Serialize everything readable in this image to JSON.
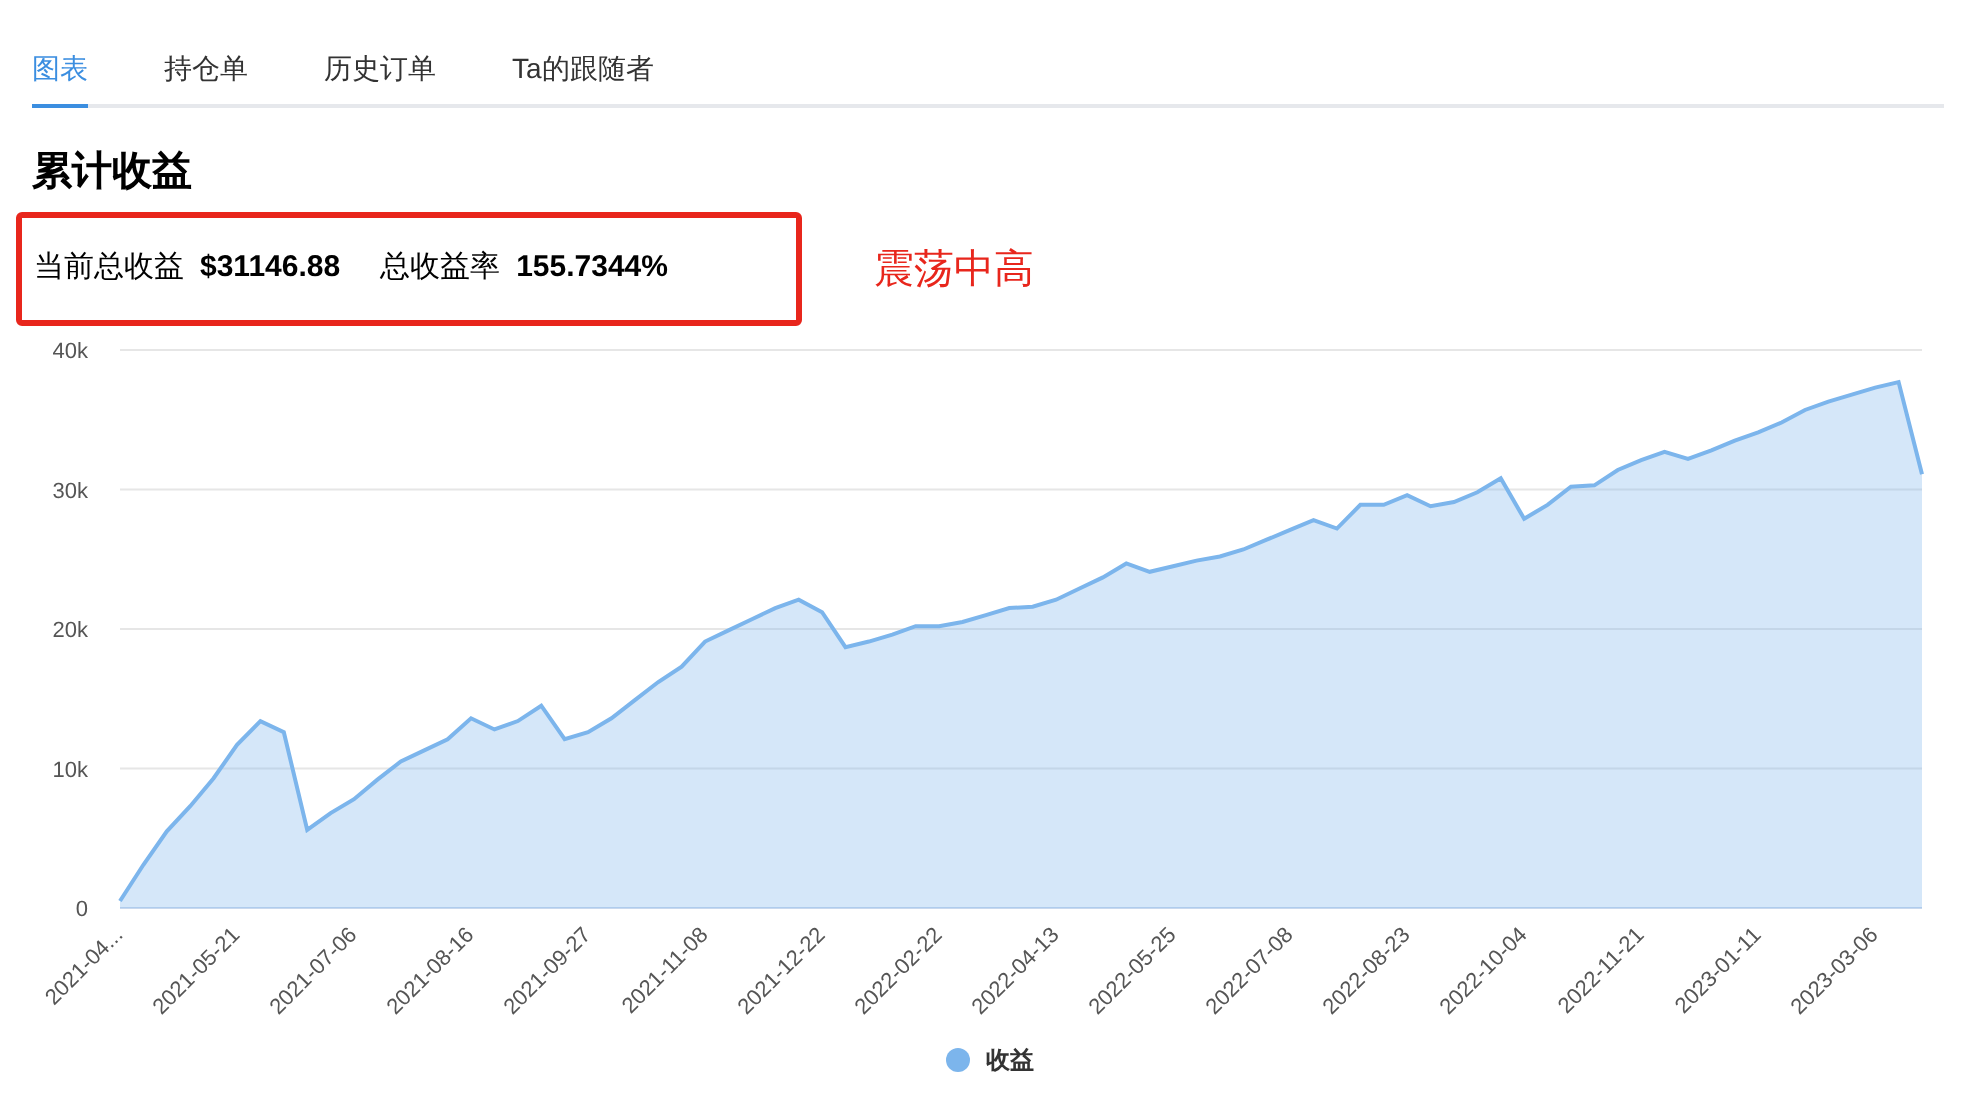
{
  "tabs": [
    {
      "label": "图表",
      "selected": true
    },
    {
      "label": "持仓单",
      "selected": false
    },
    {
      "label": "历史订单",
      "selected": false
    },
    {
      "label": "Ta的跟随者",
      "selected": false
    }
  ],
  "section_title": "累计收益",
  "summary": {
    "profit_label": "当前总收益",
    "profit_value": "$31146.88",
    "rate_label": "总收益率",
    "rate_value": "155.7344%"
  },
  "annotation": "震荡中高",
  "chart_data": {
    "type": "area",
    "categories": [
      "2021-04...",
      null,
      null,
      null,
      null,
      "2021-05-21",
      null,
      null,
      null,
      null,
      "2021-07-06",
      null,
      null,
      null,
      null,
      "2021-08-16",
      null,
      null,
      null,
      null,
      "2021-09-27",
      null,
      null,
      null,
      null,
      "2021-11-08",
      null,
      null,
      null,
      null,
      "2021-12-22",
      null,
      null,
      null,
      null,
      "2022-02-22",
      null,
      null,
      null,
      null,
      "2022-04-13",
      null,
      null,
      null,
      null,
      "2022-05-25",
      null,
      null,
      null,
      null,
      "2022-07-08",
      null,
      null,
      null,
      null,
      "2022-08-23",
      null,
      null,
      null,
      null,
      "2022-10-04",
      null,
      null,
      null,
      null,
      "2022-11-21",
      null,
      null,
      null,
      null,
      "2023-01-11",
      null,
      null,
      null,
      null,
      "2023-03-06",
      null,
      null
    ],
    "grid": true,
    "ylim": [
      0,
      40000
    ],
    "yticks": [
      {
        "value": 0,
        "label": "0"
      },
      {
        "value": 10000,
        "label": "10k"
      },
      {
        "value": 20000,
        "label": "20k"
      },
      {
        "value": 30000,
        "label": "30k"
      },
      {
        "value": 40000,
        "label": "40k"
      }
    ],
    "series": [
      {
        "name": "收益",
        "color": "#7cb5ec",
        "values": [
          500,
          3100,
          5500,
          7300,
          9300,
          11700,
          13400,
          12600,
          5600,
          6800,
          7800,
          9200,
          10500,
          11300,
          12100,
          13600,
          12800,
          13400,
          14500,
          12100,
          12600,
          13600,
          14900,
          16200,
          17300,
          19100,
          19900,
          20700,
          21500,
          22100,
          21200,
          18700,
          19100,
          19600,
          20200,
          20200,
          20500,
          21000,
          21500,
          21600,
          22100,
          22900,
          23700,
          24700,
          24100,
          24500,
          24900,
          25200,
          25700,
          26400,
          27100,
          27800,
          27200,
          28900,
          28900,
          29600,
          28800,
          29100,
          29800,
          30800,
          27900,
          28900,
          30200,
          30300,
          31400,
          32100,
          32700,
          32200,
          32800,
          33500,
          34100,
          34800,
          35700,
          36300,
          36800,
          37300,
          37700,
          31100
        ]
      }
    ]
  }
}
